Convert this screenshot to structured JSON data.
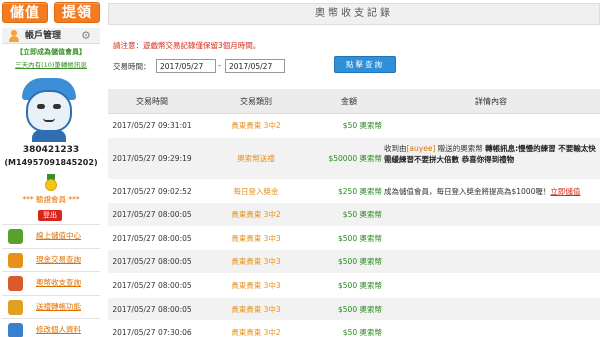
{
  "top_buttons": {
    "deposit": "儲值",
    "withdraw": "提領"
  },
  "account": {
    "title": "帳戶管理",
    "vip_link": "【立即成為儲值會員】",
    "notice_link": "三天內有(10)筆轉帳訊息",
    "user_id": "380421233",
    "member_code": "(M14957091845202)",
    "member_level": "*** 驗證會員 ***",
    "logout_label": "登出"
  },
  "menu": [
    {
      "label": "線上儲值中心",
      "icon": "deposit-icon",
      "color": "#5aa02c"
    },
    {
      "label": "現金交易查詢",
      "icon": "cash-search-icon",
      "color": "#e8901a"
    },
    {
      "label": "奧幣收支查詢",
      "icon": "coin-record-icon",
      "color": "#d95b2a"
    },
    {
      "label": "送禮轉帳功能",
      "icon": "gift-transfer-icon",
      "color": "#e0a020"
    },
    {
      "label": "修改個人資料",
      "icon": "profile-edit-icon",
      "color": "#3a7fd0"
    }
  ],
  "page": {
    "title": "奧幣收支記錄",
    "notice": "請注意：遊戲幣交易記錄僅保留3個月時間。",
    "time_label": "交易時間：",
    "date_from": "2017/05/27",
    "dash": "-",
    "date_to": "2017/05/27",
    "query_button": "點擊查詢"
  },
  "table": {
    "headers": [
      "交易時間",
      "交易類別",
      "金額",
      "詳情內容"
    ],
    "rows": [
      {
        "time": "2017/05/27 09:31:01",
        "type": "貴東貴東 3中2",
        "amount": "$50 奧索幣",
        "detail": ""
      },
      {
        "time": "2017/05/27 09:29:19",
        "type": "奧索幣送禮",
        "amount": "$50000 奧索幣",
        "detail_prefix": "收到由",
        "detail_name": "[auyee]",
        "detail_mid": " 贈送的奧索幣 ",
        "detail_bold": "轉帳訊息:慢慢的練習 不要輸太快 需緩練習不要拼大倍數 恭喜你得到禮物"
      },
      {
        "time": "2017/05/27 09:02:52",
        "type": "每日登入獎金",
        "amount": "$250 奧索幣",
        "detail_prefix": "成為儲值會員，每日登入獎金將提高為$1000喔！",
        "detail_link": "立即儲值"
      },
      {
        "time": "2017/05/27 08:00:05",
        "type": "貴東貴東 3中2",
        "amount": "$50 奧索幣",
        "detail": ""
      },
      {
        "time": "2017/05/27 08:00:05",
        "type": "貴東貴東 3中3",
        "amount": "$500 奧索幣",
        "detail": ""
      },
      {
        "time": "2017/05/27 08:00:05",
        "type": "貴東貴東 3中3",
        "amount": "$500 奧索幣",
        "detail": ""
      },
      {
        "time": "2017/05/27 08:00:05",
        "type": "貴東貴東 3中3",
        "amount": "$500 奧索幣",
        "detail": ""
      },
      {
        "time": "2017/05/27 08:00:05",
        "type": "貴東貴東 3中3",
        "amount": "$500 奧索幣",
        "detail": ""
      },
      {
        "time": "2017/05/27 07:30:06",
        "type": "貴東貴東 3中2",
        "amount": "$50 奧索幣",
        "detail": ""
      }
    ]
  },
  "colors": {
    "accent": "#f47b20",
    "link": "#e07000",
    "money": "#2a8a20",
    "alert": "#d42a1a",
    "button": "#2f8fd8"
  }
}
